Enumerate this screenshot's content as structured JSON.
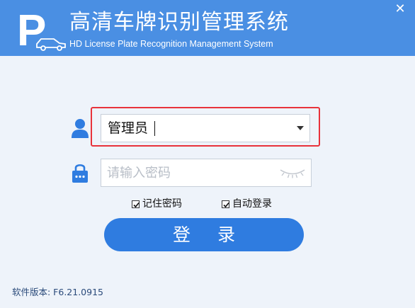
{
  "app": {
    "title_zh": "高清车牌识别管理系统",
    "title_en": "HD License Plate Recognition Management System",
    "logo_letter": "P",
    "close_glyph": "✕"
  },
  "login": {
    "user_value": "管理员",
    "password_placeholder": "请输入密码",
    "remember_password_label": "记住密码",
    "remember_password_checked": true,
    "auto_login_label": "自动登录",
    "auto_login_checked": true,
    "login_button_label": "登录"
  },
  "footer": {
    "version_text": "软件版本: F6.21.0915"
  },
  "icons": {
    "user": "user-icon",
    "lock": "lock-icon",
    "dropdown": "chevron-down-icon",
    "eye": "eye-closed-icon",
    "car": "car-icon"
  },
  "colors": {
    "header_bg": "#4a8fe3",
    "accent": "#2f7ce0",
    "highlight": "#e8323a",
    "body_bg": "#eef3fa"
  }
}
